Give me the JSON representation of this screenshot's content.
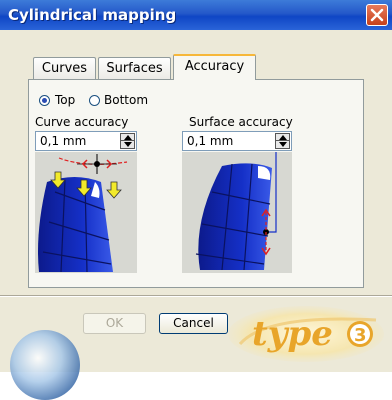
{
  "window": {
    "title": "Cylindrical mapping"
  },
  "tabs": [
    {
      "label": "Curves",
      "active": false
    },
    {
      "label": "Surfaces",
      "active": false
    },
    {
      "label": "Accuracy",
      "active": true
    }
  ],
  "accuracy": {
    "top_label": "Top",
    "bottom_label": "Bottom",
    "selected_side": "Top",
    "curve_accuracy_label": "Curve accuracy",
    "curve_accuracy_value": "0,1 mm",
    "surface_accuracy_label": "Surface accuracy",
    "surface_accuracy_value": "0,1 mm"
  },
  "buttons": {
    "ok": "OK",
    "cancel": "Cancel"
  },
  "logo": {
    "text": "type3"
  },
  "colors": {
    "titlebar": "#0f46c5",
    "surface_blue": "#1530c8",
    "arrow_yellow": "#f2ea2a",
    "accent_red": "#e02020",
    "logo_orange": "#e8a52a"
  }
}
